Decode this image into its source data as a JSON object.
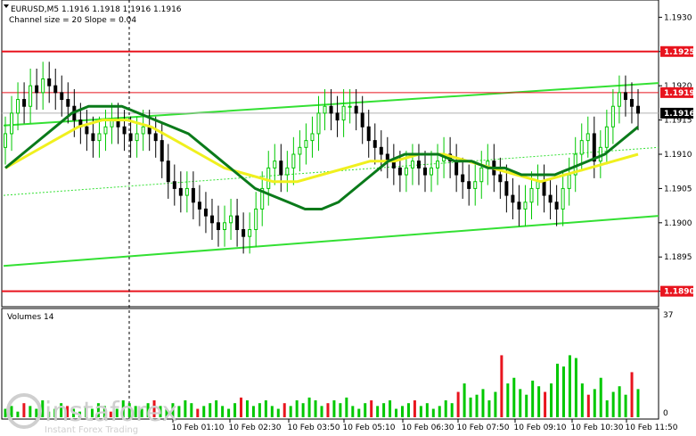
{
  "header": {
    "symbol_line": "EURUSD,M5  1.1916 1.1918 1.1916 1.1916",
    "indicator_line": "Channel size = 20 Slope = 0.04"
  },
  "volume_panel": {
    "title": "Volumes 14",
    "max_label": "37",
    "min_label": "0"
  },
  "price_axis": {
    "ticks": [
      "1.1930",
      "1.1925",
      "1.1920",
      "1.1915",
      "1.1910",
      "1.1905",
      "1.1900",
      "1.1895",
      "1.1890"
    ],
    "tags": [
      {
        "label": "1.1925",
        "color": "#e8141e"
      },
      {
        "label": "1.1919",
        "color": "#e8141e"
      },
      {
        "label": "1.1916",
        "color": "#000000"
      },
      {
        "label": "1.1890",
        "color": "#e8141e"
      }
    ]
  },
  "time_axis": {
    "labels": [
      "10 Feb 01:10",
      "10 Feb 02:30",
      "10 Feb 03:50",
      "10 Feb 05:10",
      "10 Feb 06:30",
      "10 Feb 07:50",
      "10 Feb 09:10",
      "10 Feb 10:30",
      "10 Feb 11:50"
    ]
  },
  "watermark": {
    "brand": "instaforex",
    "tagline": "Instant Forex Trading"
  },
  "colors": {
    "bull": "#00c800",
    "bear": "#000000",
    "sma_fast": "#0a7a1a",
    "sma_slow": "#f0f01e",
    "channel": "#33e033",
    "level_line": "#e8141e",
    "volume_bar": "#00c800",
    "volume_bar_down": "#e8141e"
  },
  "chart_data": {
    "type": "candlestick",
    "symbol": "EURUSD",
    "timeframe": "M5",
    "ylim": [
      1.1888,
      1.1932
    ],
    "horizontal_levels": [
      1.1925,
      1.1919,
      1.189
    ],
    "last_price": 1.1916,
    "closes": [
      1.1913,
      1.1916,
      1.1918,
      1.1917,
      1.192,
      1.1919,
      1.1921,
      1.192,
      1.1919,
      1.1918,
      1.1917,
      1.1915,
      1.1914,
      1.1913,
      1.1912,
      1.1913,
      1.1914,
      1.1915,
      1.1914,
      1.1913,
      1.1912,
      1.1913,
      1.1914,
      1.1913,
      1.1912,
      1.1909,
      1.1906,
      1.1905,
      1.1904,
      1.1905,
      1.1903,
      1.1902,
      1.1901,
      1.19,
      1.1899,
      1.19,
      1.1901,
      1.1899,
      1.1898,
      1.1899,
      1.1902,
      1.1905,
      1.1908,
      1.1909,
      1.1907,
      1.1908,
      1.191,
      1.1911,
      1.1912,
      1.1913,
      1.1916,
      1.1917,
      1.1916,
      1.1915,
      1.1917,
      1.1917,
      1.1916,
      1.1914,
      1.1912,
      1.1911,
      1.191,
      1.1909,
      1.1908,
      1.1907,
      1.1908,
      1.1909,
      1.1908,
      1.1907,
      1.1908,
      1.1909,
      1.191,
      1.1909,
      1.1907,
      1.1906,
      1.1905,
      1.1906,
      1.1908,
      1.1909,
      1.1907,
      1.1906,
      1.1904,
      1.1903,
      1.1902,
      1.1903,
      1.1905,
      1.1906,
      1.1904,
      1.1903,
      1.1902,
      1.1905,
      1.1907,
      1.191,
      1.1912,
      1.1913,
      1.1909,
      1.1911,
      1.1914,
      1.1917,
      1.1919,
      1.1918,
      1.1917,
      1.1916
    ],
    "volumes": [
      3,
      4,
      2,
      5,
      4,
      3,
      6,
      2,
      3,
      5,
      4,
      3,
      2,
      4,
      3,
      5,
      4,
      2,
      3,
      6,
      5,
      4,
      3,
      5,
      6,
      4,
      3,
      5,
      4,
      6,
      5,
      3,
      4,
      5,
      6,
      4,
      3,
      5,
      7,
      6,
      4,
      5,
      6,
      4,
      3,
      5,
      4,
      6,
      5,
      7,
      6,
      4,
      5,
      6,
      5,
      7,
      4,
      3,
      5,
      6,
      4,
      5,
      6,
      3,
      4,
      5,
      6,
      4,
      5,
      3,
      4,
      6,
      5,
      9,
      12,
      7,
      8,
      10,
      6,
      9,
      22,
      12,
      14,
      10,
      8,
      13,
      11,
      9,
      12,
      19,
      18,
      22,
      21,
      12,
      8,
      10,
      14,
      6,
      9,
      11,
      8,
      16,
      10
    ],
    "sma_fast": [
      1.1908,
      1.191,
      1.1912,
      1.1914,
      1.1916,
      1.1917,
      1.1917,
      1.1917,
      1.1916,
      1.1915,
      1.1914,
      1.1913,
      1.1911,
      1.1909,
      1.1907,
      1.1905,
      1.1904,
      1.1903,
      1.1902,
      1.1902,
      1.1903,
      1.1905,
      1.1907,
      1.1909,
      1.191,
      1.191,
      1.191,
      1.1909,
      1.1909,
      1.1908,
      1.1908,
      1.1907,
      1.1907,
      1.1907,
      1.1908,
      1.1909,
      1.191,
      1.1912,
      1.1914
    ],
    "sma_slow": [
      1.1908,
      1.191,
      1.1912,
      1.1914,
      1.1915,
      1.1915,
      1.1914,
      1.1912,
      1.191,
      1.1908,
      1.1907,
      1.1906,
      1.1906,
      1.1907,
      1.1908,
      1.1909,
      1.1909,
      1.191,
      1.191,
      1.1909,
      1.1908,
      1.1907,
      1.1906,
      1.1907,
      1.1908,
      1.1909,
      1.191
    ]
  }
}
